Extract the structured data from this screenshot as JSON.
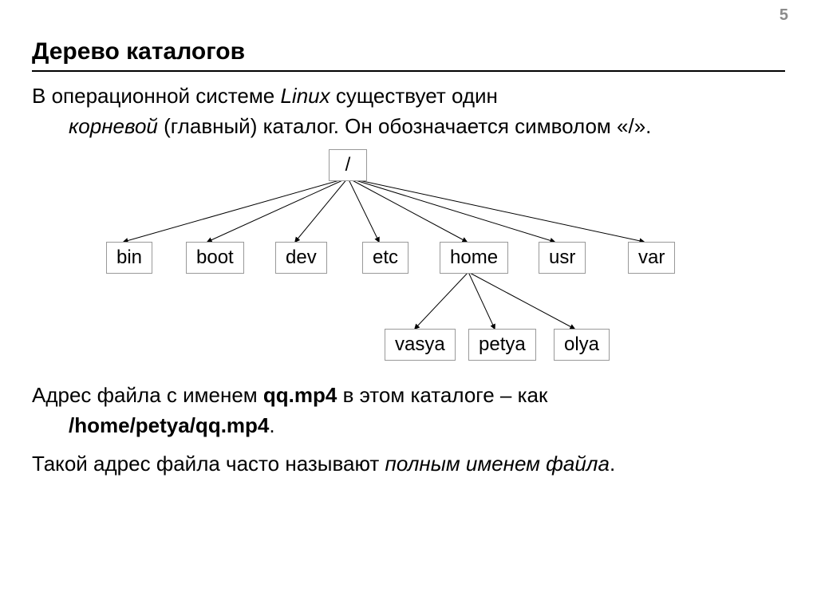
{
  "page_number": "5",
  "heading": "Дерево каталогов",
  "body": {
    "p1_pre": "В операционной системе ",
    "p1_os": "Linux",
    "p1_post1": " существует один ",
    "p1_root": "корневой",
    "p1_post2": " (главный) каталог. Он обозначается символом «/».",
    "p2_pre": "Адрес файла с именем ",
    "p2_file": "qq.mp4",
    "p2_mid": " в этом каталоге – как ",
    "p2_path": "/home/petya/qq.mp4",
    "p2_post": ".",
    "p3_pre": "Такой адрес файла часто называют ",
    "p3_em": "полным именем файла",
    "p3_post": "."
  },
  "tree": {
    "root": "/",
    "level1": {
      "bin": "bin",
      "boot": "boot",
      "dev": "dev",
      "etc": "etc",
      "home": "home",
      "usr": "usr",
      "var": "var"
    },
    "level2": {
      "vasya": "vasya",
      "petya": "petya",
      "olya": "olya"
    }
  }
}
